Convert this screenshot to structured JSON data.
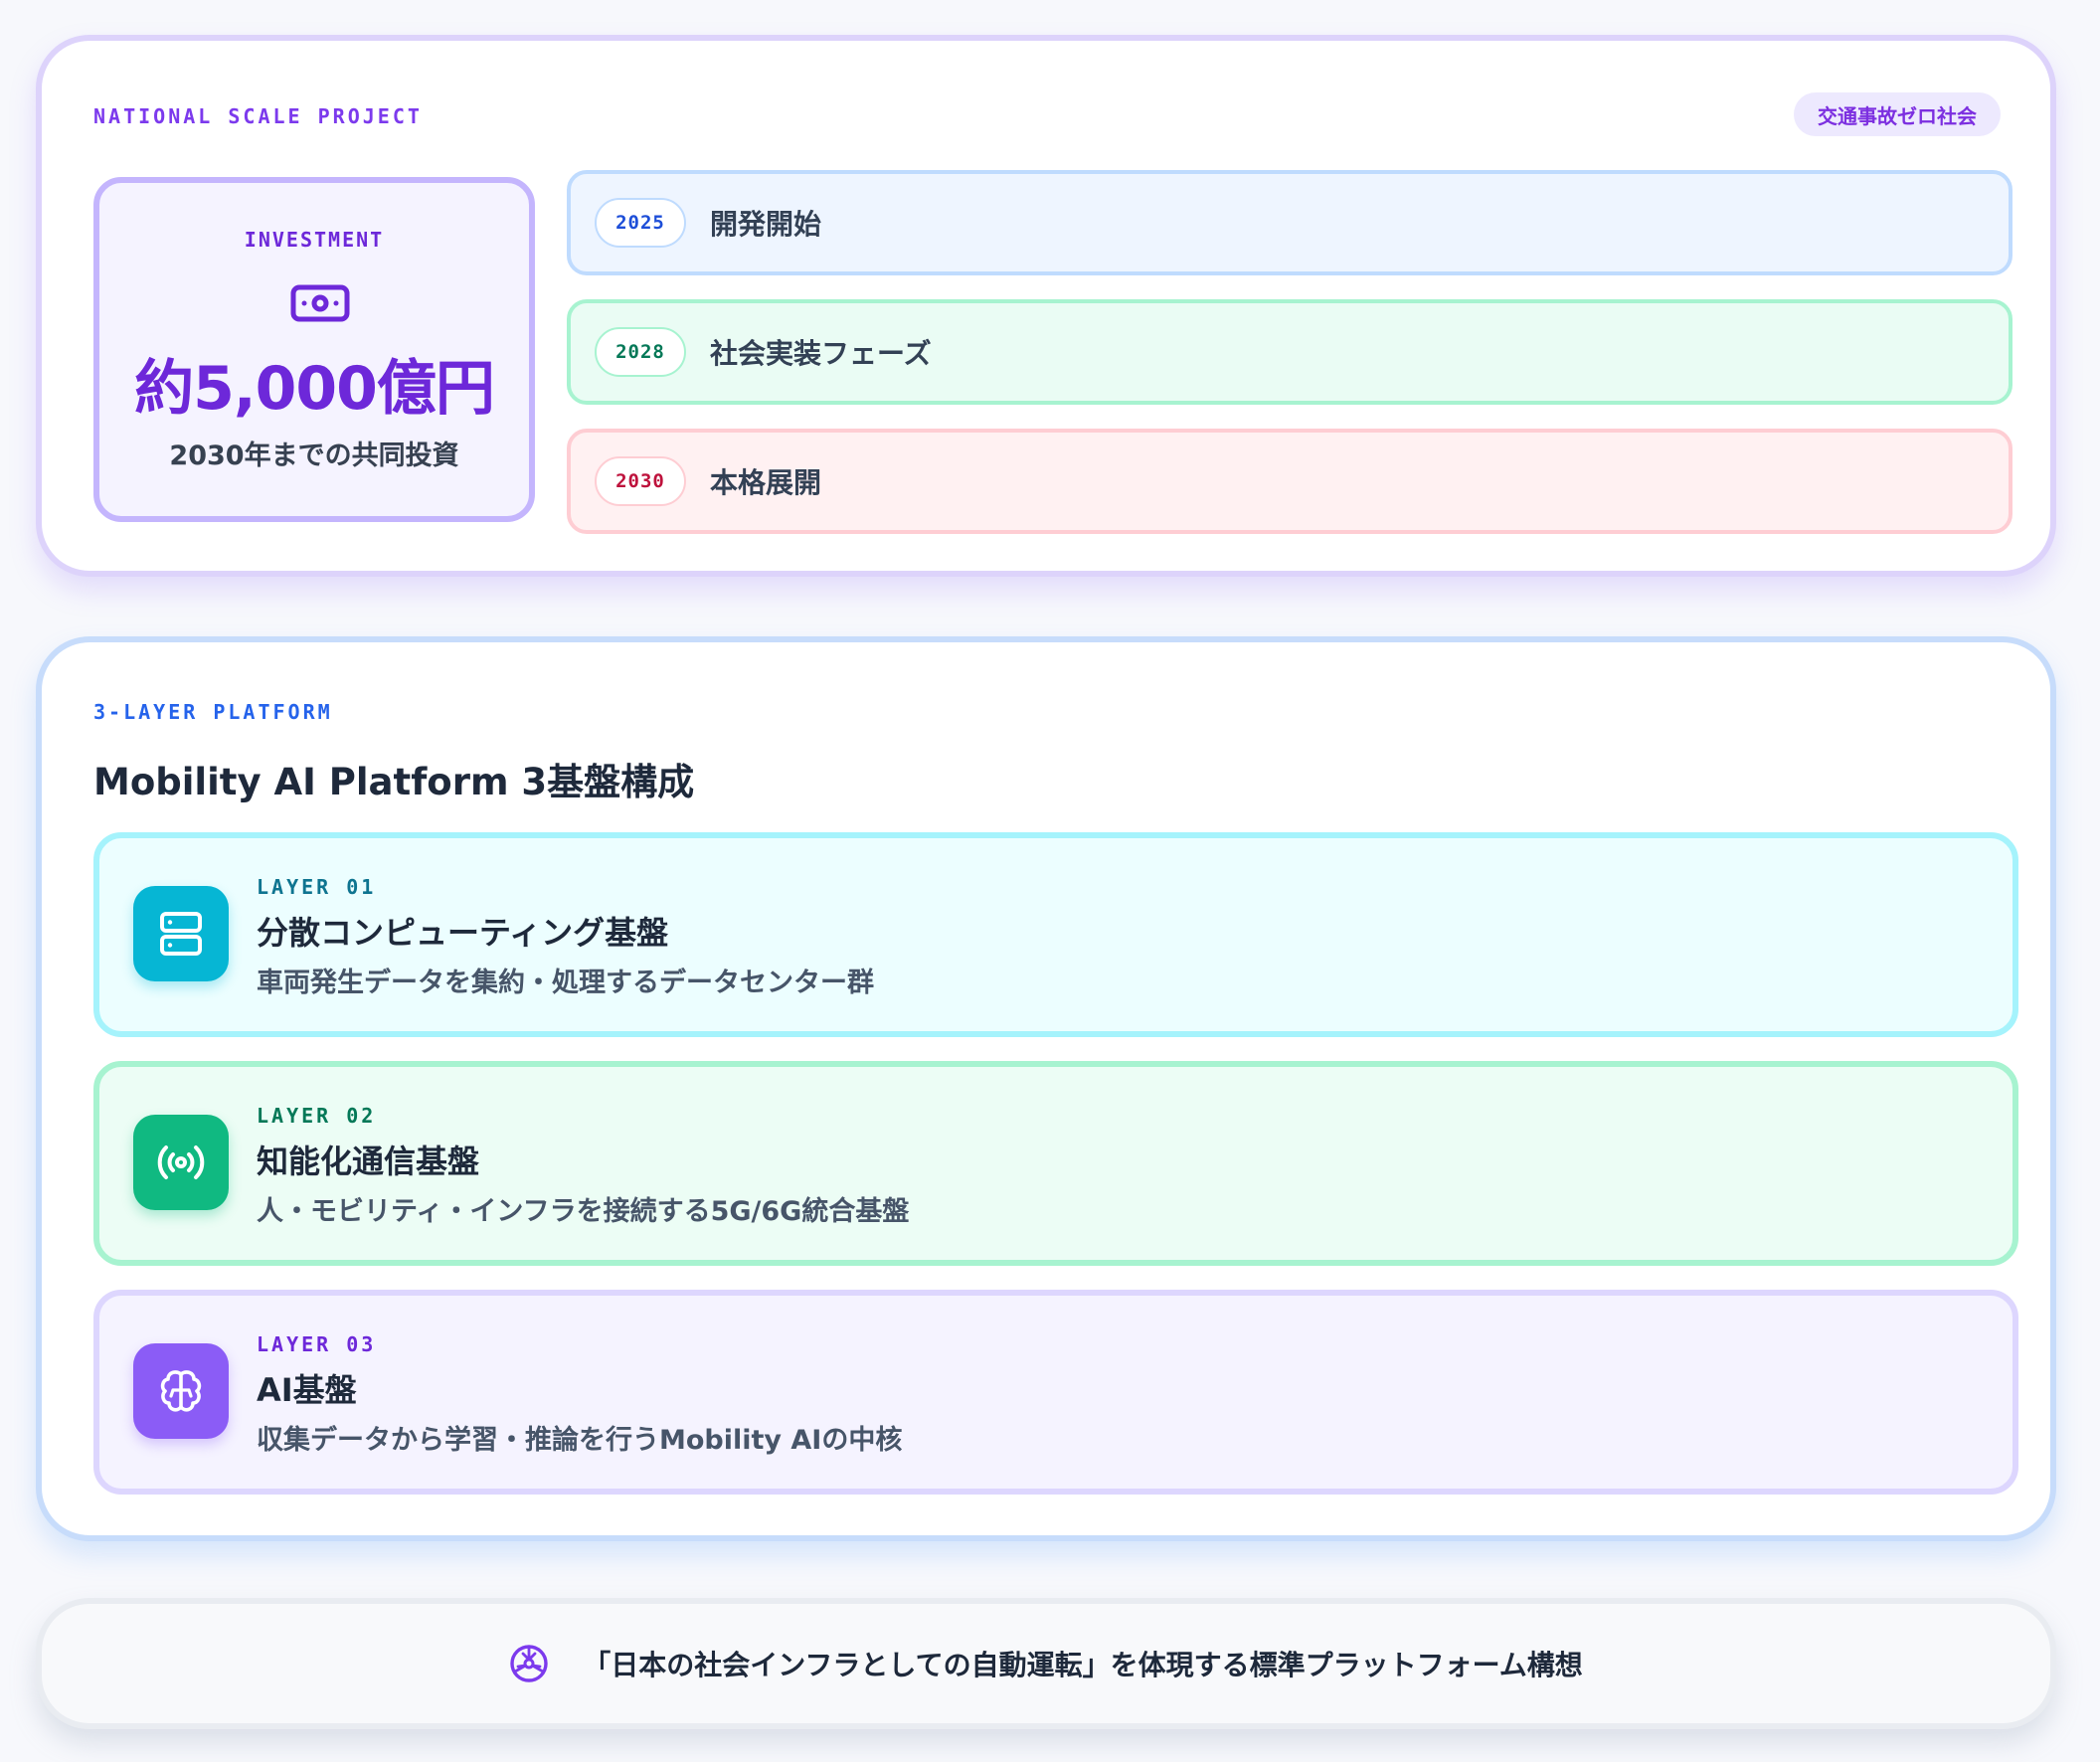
{
  "national": {
    "kicker": "NATIONAL SCALE PROJECT",
    "badge": "交通事故ゼロ社会",
    "investment": {
      "kicker": "INVESTMENT",
      "icon": "banknote-icon",
      "amount": "約5,000億円",
      "note": "2030年までの共同投資"
    },
    "milestones": [
      {
        "year": "2025",
        "label": "開発開始",
        "color": "#1d4ed8"
      },
      {
        "year": "2028",
        "label": "社会実装フェーズ",
        "color": "#047857"
      },
      {
        "year": "2030",
        "label": "本格展開",
        "color": "#be123c"
      }
    ]
  },
  "platform": {
    "kicker": "3-LAYER PLATFORM",
    "title": "Mobility AI Platform 3基盤構成",
    "layers": [
      {
        "kicker": "LAYER 01",
        "title": "分散コンピューティング基盤",
        "desc": "車両発生データを集約・処理するデータセンター群",
        "icon": "server-icon",
        "color": "#06b6d4"
      },
      {
        "kicker": "LAYER 02",
        "title": "知能化通信基盤",
        "desc": "人・モビリティ・インフラを接続する5G/6G統合基盤",
        "icon": "broadcast-icon",
        "color": "#10b981"
      },
      {
        "kicker": "LAYER 03",
        "title": "AI基盤",
        "desc": "収集データから学習・推論を行うMobility AIの中核",
        "icon": "brain-icon",
        "color": "#8b5cf6"
      }
    ]
  },
  "footer": {
    "icon": "network-icon",
    "text": "「日本の社会インフラとしての自動運転」を体現する標準プラットフォーム構想"
  }
}
